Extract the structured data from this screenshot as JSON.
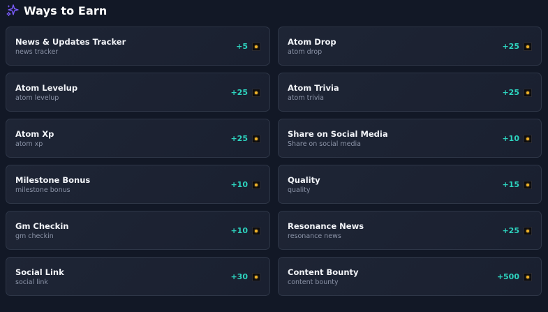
{
  "header": {
    "title": "Ways to Earn",
    "icon": "sparkles-icon",
    "icon_color": "#7c5cff"
  },
  "accent": {
    "points_color": "#2dd4bf",
    "coin_color": "#f0b429"
  },
  "tasks": [
    {
      "name": "News & Updates Tracker",
      "sub": "news tracker",
      "points": "+5"
    },
    {
      "name": "Atom Drop",
      "sub": "atom drop",
      "points": "+25"
    },
    {
      "name": "Atom Levelup",
      "sub": "atom levelup",
      "points": "+25"
    },
    {
      "name": "Atom Trivia",
      "sub": "atom trivia",
      "points": "+25"
    },
    {
      "name": "Atom Xp",
      "sub": "atom xp",
      "points": "+25"
    },
    {
      "name": "Share on Social Media",
      "sub": "Share on social media",
      "points": "+10"
    },
    {
      "name": "Milestone Bonus",
      "sub": "milestone bonus",
      "points": "+10"
    },
    {
      "name": "Quality",
      "sub": "quality",
      "points": "+15"
    },
    {
      "name": "Gm Checkin",
      "sub": "gm checkin",
      "points": "+10"
    },
    {
      "name": "Resonance News",
      "sub": "resonance news",
      "points": "+25"
    },
    {
      "name": "Social Link",
      "sub": "social link",
      "points": "+30"
    },
    {
      "name": "Content Bounty",
      "sub": "content bounty",
      "points": "+500"
    }
  ]
}
